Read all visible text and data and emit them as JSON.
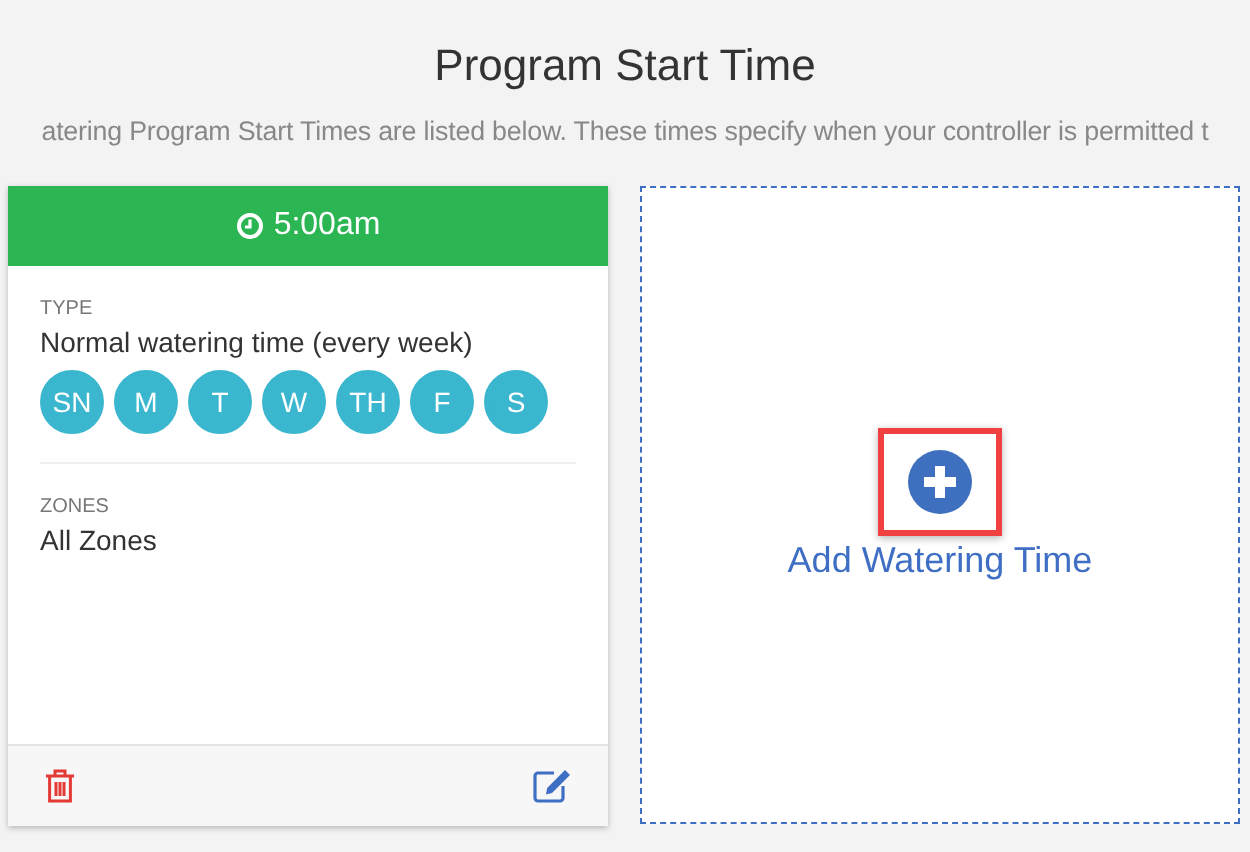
{
  "title": "Program Start Time",
  "subtitle": "atering Program Start Times are listed below. These times specify when your controller is permitted t",
  "program": {
    "time": "5:00am",
    "type_label": "TYPE",
    "type_value": "Normal watering time (every week)",
    "days": [
      {
        "label": "SN",
        "on": true
      },
      {
        "label": "M",
        "on": true
      },
      {
        "label": "T",
        "on": true
      },
      {
        "label": "W",
        "on": true
      },
      {
        "label": "TH",
        "on": true
      },
      {
        "label": "F",
        "on": true
      },
      {
        "label": "S",
        "on": true
      }
    ],
    "zones_label": "ZONES",
    "zones_value": "All Zones"
  },
  "add": {
    "label": "Add Watering Time",
    "highlighted": true
  }
}
